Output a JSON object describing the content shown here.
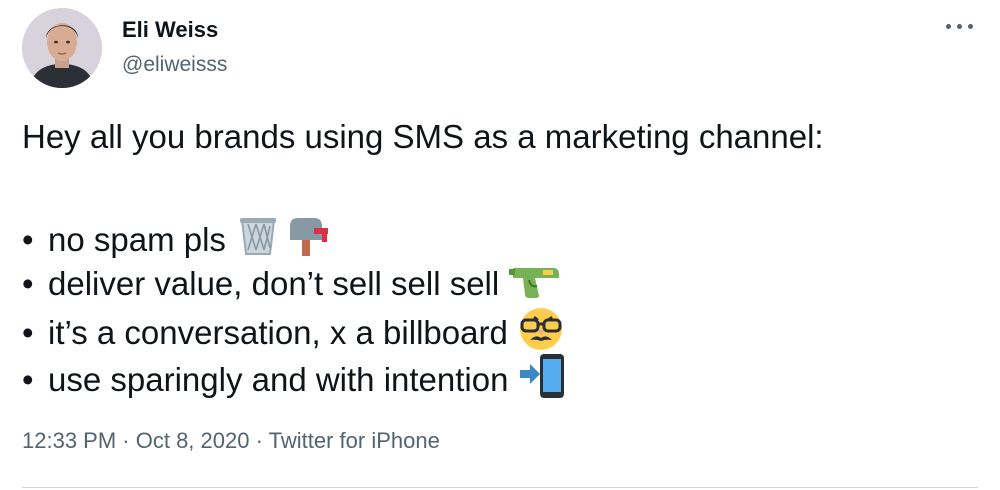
{
  "author": {
    "name": "Eli Weiss",
    "handle": "@eliweisss"
  },
  "tweet": {
    "intro": "Hey all you brands using SMS as a marketing channel:",
    "bullet_char": "•",
    "items": [
      {
        "text": "no spam pls",
        "icons": [
          "wastebasket-icon",
          "mailbox-icon"
        ]
      },
      {
        "text": "deliver value, don’t sell sell sell",
        "icons": [
          "water-pistol-icon"
        ]
      },
      {
        "text": "it’s a conversation, x a billboard",
        "icons": [
          "disguised-face-icon"
        ]
      },
      {
        "text": "use sparingly and with intention",
        "icons": [
          "mobile-arrow-icon"
        ]
      }
    ]
  },
  "meta": {
    "time": "12:33 PM",
    "separator": " · ",
    "date": "Oct 8, 2020",
    "source": "Twitter for iPhone"
  },
  "colors": {
    "text": "#0f1419",
    "secondary": "#536471",
    "divider": "#cfd9de"
  }
}
